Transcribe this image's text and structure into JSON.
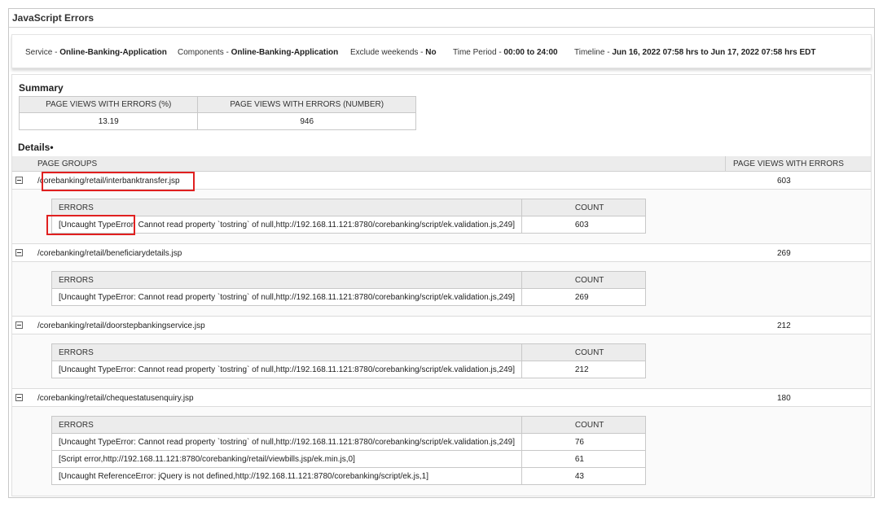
{
  "title": "JavaScript Errors",
  "filters": [
    {
      "label": "Service - ",
      "value": "Online-Banking-Application"
    },
    {
      "label": "Components - ",
      "value": "Online-Banking-Application"
    },
    {
      "label": "Exclude weekends - ",
      "value": "No"
    },
    {
      "label": "Time Period - ",
      "value": "00:00 to 24:00"
    },
    {
      "label": "Timeline - ",
      "value": "Jun 16, 2022 07:58 hrs to Jun 17, 2022 07:58 hrs EDT"
    }
  ],
  "summary": {
    "label": "Summary",
    "headers": [
      "PAGE VIEWS WITH ERRORS (%)",
      "PAGE VIEWS WITH ERRORS (NUMBER)"
    ],
    "values": [
      "13.19",
      "946"
    ]
  },
  "details": {
    "label": "Details•",
    "header_groups": "PAGE GROUPS",
    "header_views": "PAGE VIEWS WITH ERRORS",
    "errors_header": "ERRORS",
    "count_header": "COUNT",
    "groups": [
      {
        "name": "/corebanking/retail/interbanktransfer.jsp",
        "count": "603",
        "errors": [
          {
            "text": "[Uncaught TypeError: Cannot read property `tostring` of null,http://192.168.11.121:8780/corebanking/script/ek.validation.js,249]",
            "count": "603"
          }
        ]
      },
      {
        "name": "/corebanking/retail/beneficiarydetails.jsp",
        "count": "269",
        "errors": [
          {
            "text": "[Uncaught TypeError: Cannot read property `tostring` of null,http://192.168.11.121:8780/corebanking/script/ek.validation.js,249]",
            "count": "269"
          }
        ]
      },
      {
        "name": "/corebanking/retail/doorstepbankingservice.jsp",
        "count": "212",
        "errors": [
          {
            "text": "[Uncaught TypeError: Cannot read property `tostring` of null,http://192.168.11.121:8780/corebanking/script/ek.validation.js,249]",
            "count": "212"
          }
        ]
      },
      {
        "name": "/corebanking/retail/chequestatusenquiry.jsp",
        "count": "180",
        "errors": [
          {
            "text": "[Uncaught TypeError: Cannot read property `tostring` of null,http://192.168.11.121:8780/corebanking/script/ek.validation.js,249]",
            "count": "76"
          },
          {
            "text": "[Script error,http://192.168.11.121:8780/corebanking/retail/viewbills.jsp/ek.min.js,0]",
            "count": "61"
          },
          {
            "text": "[Uncaught ReferenceError: jQuery is not defined,http://192.168.11.121:8780/corebanking/script/ek.js,1]",
            "count": "43"
          }
        ]
      }
    ]
  },
  "annotation_color": "#e02020"
}
